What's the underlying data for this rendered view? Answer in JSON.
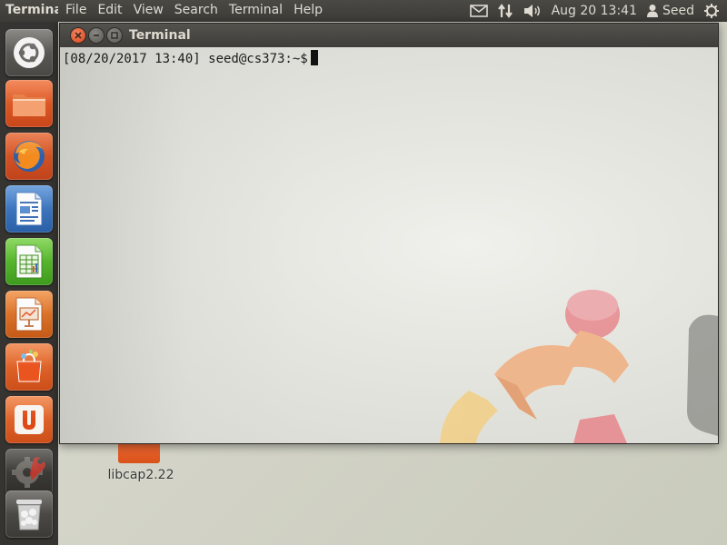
{
  "top_panel": {
    "app_title": "Terminal",
    "menu": [
      "File",
      "Edit",
      "View",
      "Search",
      "Terminal",
      "Help"
    ],
    "indicators": {
      "mail_icon": "envelope-icon",
      "network_icon": "network-updown-icon",
      "sound_icon": "speaker-icon",
      "clock": "Aug 20 13:41",
      "user_icon": "person-icon",
      "user_name": "Seed",
      "session_icon": "gear-power-icon"
    }
  },
  "launcher": {
    "items": [
      {
        "name": "dash-home",
        "icon": "ubuntu-logo-icon"
      },
      {
        "name": "files",
        "icon": "folder-icon"
      },
      {
        "name": "firefox",
        "icon": "firefox-icon"
      },
      {
        "name": "libreoffice-writer",
        "icon": "writer-document-icon"
      },
      {
        "name": "libreoffice-calc",
        "icon": "calc-spreadsheet-icon"
      },
      {
        "name": "libreoffice-impress",
        "icon": "impress-presentation-icon"
      },
      {
        "name": "software-center",
        "icon": "shopping-bag-icon"
      },
      {
        "name": "ubuntu-one",
        "icon": "ubuntu-one-icon"
      },
      {
        "name": "system-settings",
        "icon": "settings-wrench-icon"
      },
      {
        "name": "trash",
        "icon": "trash-icon"
      }
    ]
  },
  "desktop": {
    "folder_label": "libcap2.22"
  },
  "terminal": {
    "window_title": "Terminal",
    "prompt": "[08/20/2017 13:40] seed@cs373:~$"
  },
  "colors": {
    "panel": "#3c3b37",
    "accent": "#dd4814",
    "close_button": "#e9541f",
    "text_light": "#dfdbd2"
  }
}
